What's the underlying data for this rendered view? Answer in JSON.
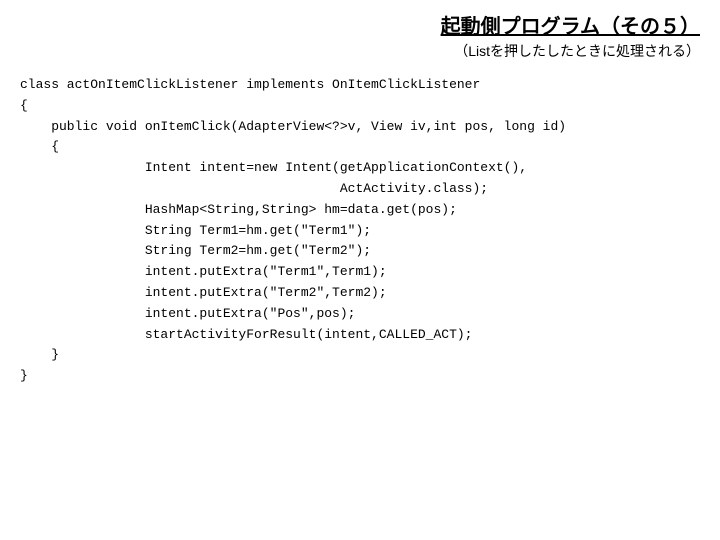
{
  "header": {
    "title": "起動側プログラム（その５）",
    "subtitle": "（Listを押したしたときに処理される）"
  },
  "code": {
    "l0": "class actOnItemClickListener implements OnItemClickListener",
    "l1": "{",
    "l2": "    public void onItemClick(AdapterView<?>v, View iv,int pos, long id)",
    "l3": "    {",
    "l4": "                Intent intent=new Intent(getApplicationContext(),",
    "l5": "                                         ActActivity.class);",
    "l6": "                HashMap<String,String> hm=data.get(pos);",
    "l7": "                String Term1=hm.get(\"Term1\");",
    "l8": "                String Term2=hm.get(\"Term2\");",
    "l9": "                intent.putExtra(\"Term1\",Term1);",
    "l10": "                intent.putExtra(\"Term2\",Term2);",
    "l11": "                intent.putExtra(\"Pos\",pos);",
    "l12": "                startActivityForResult(intent,CALLED_ACT);",
    "l13": "    }",
    "l14": "}"
  }
}
